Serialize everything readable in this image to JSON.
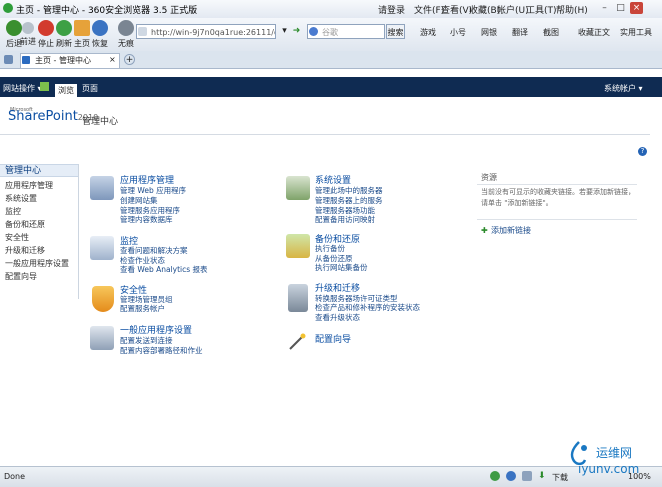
{
  "window": {
    "title": "主页 - 管理中心 - 360安全浏览器 3.5 正式版",
    "menu": [
      "请登录",
      "文件(F)",
      "查看(V)",
      "收藏(B)",
      "帐户(U)",
      "工具(T)",
      "帮助(H)"
    ]
  },
  "toolbar": {
    "buttons": [
      "后退",
      "前进",
      "停止",
      "刷新",
      "主页",
      "恢复",
      "无痕"
    ],
    "address": "http://win-9j7n0qa1rue:26111/default.a",
    "search_placeholder": "谷歌",
    "search_button": "搜索",
    "links": [
      "游戏",
      "小号",
      "网银",
      "翻译",
      "截图",
      "收藏正文",
      "实用工具"
    ]
  },
  "tabs": [
    {
      "label": "主页 - 管理中心"
    }
  ],
  "ribbon": {
    "site_actions": "网站操作",
    "tabs": [
      "浏览",
      "页面"
    ],
    "account": "系统帐户"
  },
  "header": {
    "logo_top": "Microsoft",
    "logo_main": "SharePoint",
    "logo_year": "2010",
    "title": "管理中心"
  },
  "nav": {
    "heading": "管理中心",
    "items": [
      "应用程序管理",
      "系统设置",
      "监控",
      "备份和还原",
      "安全性",
      "升级和迁移",
      "一般应用程序设置",
      "配置向导"
    ]
  },
  "sections": [
    {
      "title": "应用程序管理",
      "links": [
        "管理 Web 应用程序",
        "创建网站集",
        "管理服务应用程序",
        "管理内容数据库"
      ]
    },
    {
      "title": "监控",
      "links": [
        "查看问题和解决方案",
        "检查作业状态",
        "查看 Web Analytics 报表"
      ]
    },
    {
      "title": "安全性",
      "links": [
        "管理场管理员组",
        "配置服务帐户"
      ]
    },
    {
      "title": "一般应用程序设置",
      "links": [
        "配置发送到连接",
        "配置内容部署路径和作业"
      ]
    },
    {
      "title": "系统设置",
      "links": [
        "管理此场中的服务器",
        "管理服务器上的服务",
        "管理服务器场功能",
        "配置备用访问映射"
      ]
    },
    {
      "title": "备份和还原",
      "links": [
        "执行备份",
        "从备份还原",
        "执行网站集备份"
      ]
    },
    {
      "title": "升级和迁移",
      "links": [
        "转换服务器场许可证类型",
        "检查产品和修补程序的安装状态",
        "查看升级状态"
      ]
    },
    {
      "title": "配置向导",
      "links": []
    }
  ],
  "resources": {
    "title": "资源",
    "text": "当前没有可显示的收藏夹链接。若要添加新链接，请单击 \"添加新链接\"。",
    "add_link": "添加新链接"
  },
  "status": {
    "text": "Done",
    "download": "下载",
    "zoom": "100%"
  },
  "watermark": {
    "line1": "运维网",
    "line2": "iyunv.com"
  }
}
